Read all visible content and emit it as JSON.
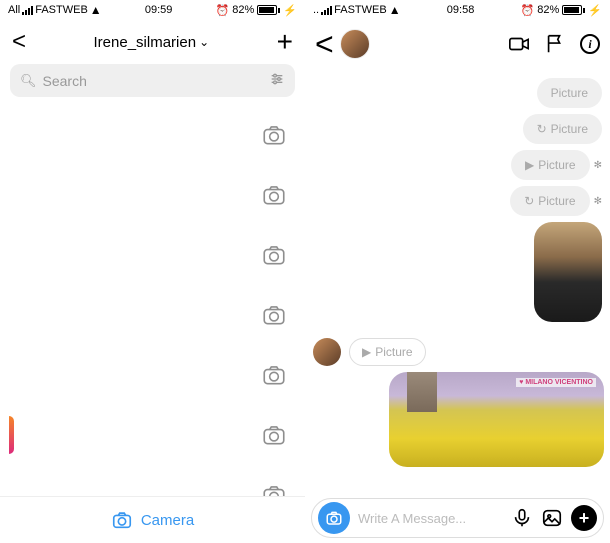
{
  "left": {
    "status": {
      "carrier": "FASTWEB",
      "time": "09:59",
      "battery": "82%"
    },
    "header": {
      "username": "Irene_silmarien"
    },
    "search": {
      "placeholder": "Search"
    },
    "camera_label": "Camera"
  },
  "right": {
    "status": {
      "carrier": "FASTWEB",
      "time": "09:58",
      "battery": "82%"
    },
    "messages": {
      "p1": "Picture",
      "p2": "Picture",
      "p3": "Picture",
      "p4": "Picture",
      "p5": "Picture"
    },
    "photo_tag": "♥ MILANO VICENTINO",
    "compose": {
      "placeholder": "Write A Message..."
    }
  }
}
